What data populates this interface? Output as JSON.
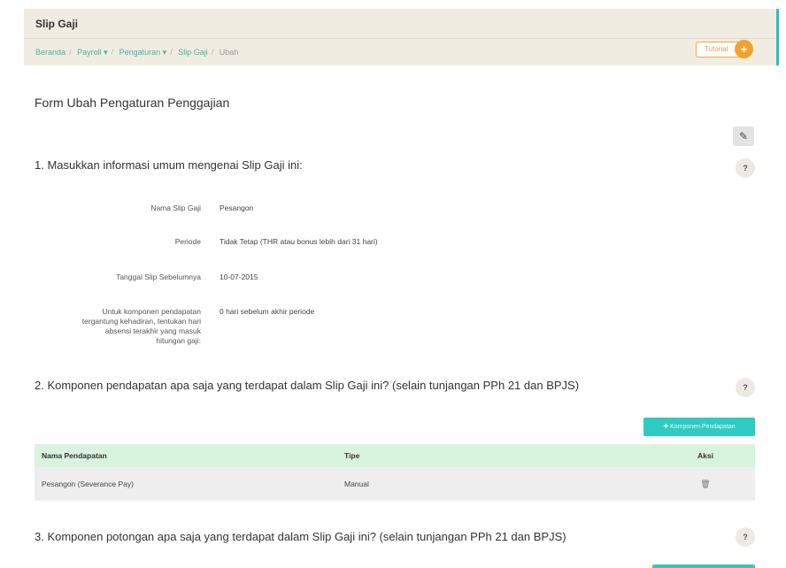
{
  "header": {
    "title": "Slip Gaji",
    "breadcrumb": [
      "Beranda",
      "Payroll ▾",
      "Pengaturan ▾",
      "Slip Gaji",
      "Ubah"
    ],
    "tutorial_label": "Tutorial",
    "tutorial_badge": "+"
  },
  "form": {
    "title": "Form Ubah Pengaturan Penggajian",
    "section1": {
      "title": "1. Masukkan informasi umum mengenai Slip Gaji ini:",
      "fields": [
        {
          "label": "Nama Slip Gaji",
          "value": "Pesangon"
        },
        {
          "label": "Periode",
          "value": "Tidak Tetap (THR atau bonus lebih dari 31 hari)"
        },
        {
          "label": "Tanggal Slip Sebelumnya",
          "value": "10-07-2015"
        },
        {
          "label": "Untuk komponen pendapatan tergantung kehadiran, tentukan hari absensi terakhir yang masuk hitungan gaji:",
          "value": "0 hari sebelum akhir periode"
        }
      ]
    },
    "section2": {
      "title": "2. Komponen pendapatan apa saja yang terdapat dalam Slip Gaji ini? (selain tunjangan PPh 21 dan BPJS)",
      "add_button": "✚ Komponen Pendapatan",
      "columns": [
        "Nama Pendapatan",
        "Tipe",
        "Aksi"
      ],
      "rows": [
        {
          "name": "Pesangon (Severance Pay)",
          "type": "Manual",
          "action_icon": "🗑"
        }
      ]
    },
    "section3": {
      "title": "3. Komponen potongan apa saja yang terdapat dalam Slip Gaji ini? (selain tunjangan PPh 21 dan BPJS)"
    },
    "help_icon": "?",
    "edit_icon": "✎"
  },
  "colors": {
    "accent": "#2fcbc2",
    "header_bg": "#f1ece1",
    "link": "#4bb1a3",
    "tutorial": "#f0a22d",
    "table_header": "#d9f4de"
  }
}
